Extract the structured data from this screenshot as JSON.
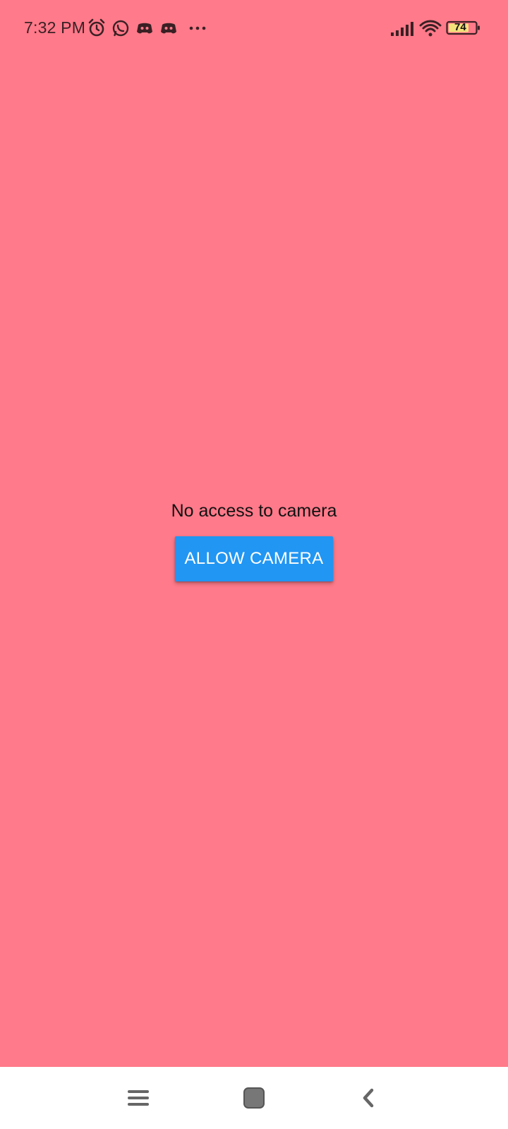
{
  "status_bar": {
    "time": "7:32 PM",
    "notification_icons": [
      "alarm-icon",
      "whatsapp-icon",
      "discord-icon",
      "discord-icon",
      "more-dots-icon"
    ],
    "battery_level": "74",
    "signal_icon": "signal-bars-icon",
    "wifi_icon": "wifi-icon"
  },
  "main": {
    "message": "No access to camera",
    "allow_button_label": "ALLOW CAMERA"
  },
  "nav_bar": {
    "menu_icon": "menu-icon",
    "home_icon": "home-square-icon",
    "back_icon": "back-chevron-icon"
  },
  "colors": {
    "background": "#ff7a8a",
    "button": "#2196f3",
    "nav_background": "#ffffff"
  }
}
